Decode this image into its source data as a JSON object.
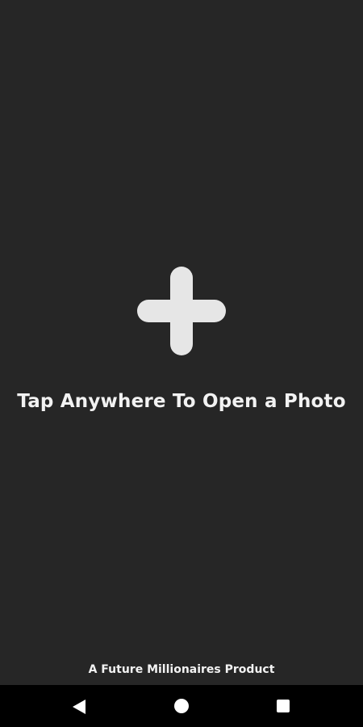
{
  "main": {
    "prompt_text": "Tap Anywhere To Open a Photo",
    "plus_icon": "plus-icon"
  },
  "footer": {
    "credit_text": "A Future Millionaires Product"
  },
  "navigation_bar": {
    "back_icon": "back-triangle-icon",
    "home_icon": "home-circle-icon",
    "recents_icon": "recents-square-icon"
  },
  "colors": {
    "background": "#262626",
    "text": "#f2f2f2",
    "icon": "#e6e6e6",
    "navbar": "#000000"
  }
}
